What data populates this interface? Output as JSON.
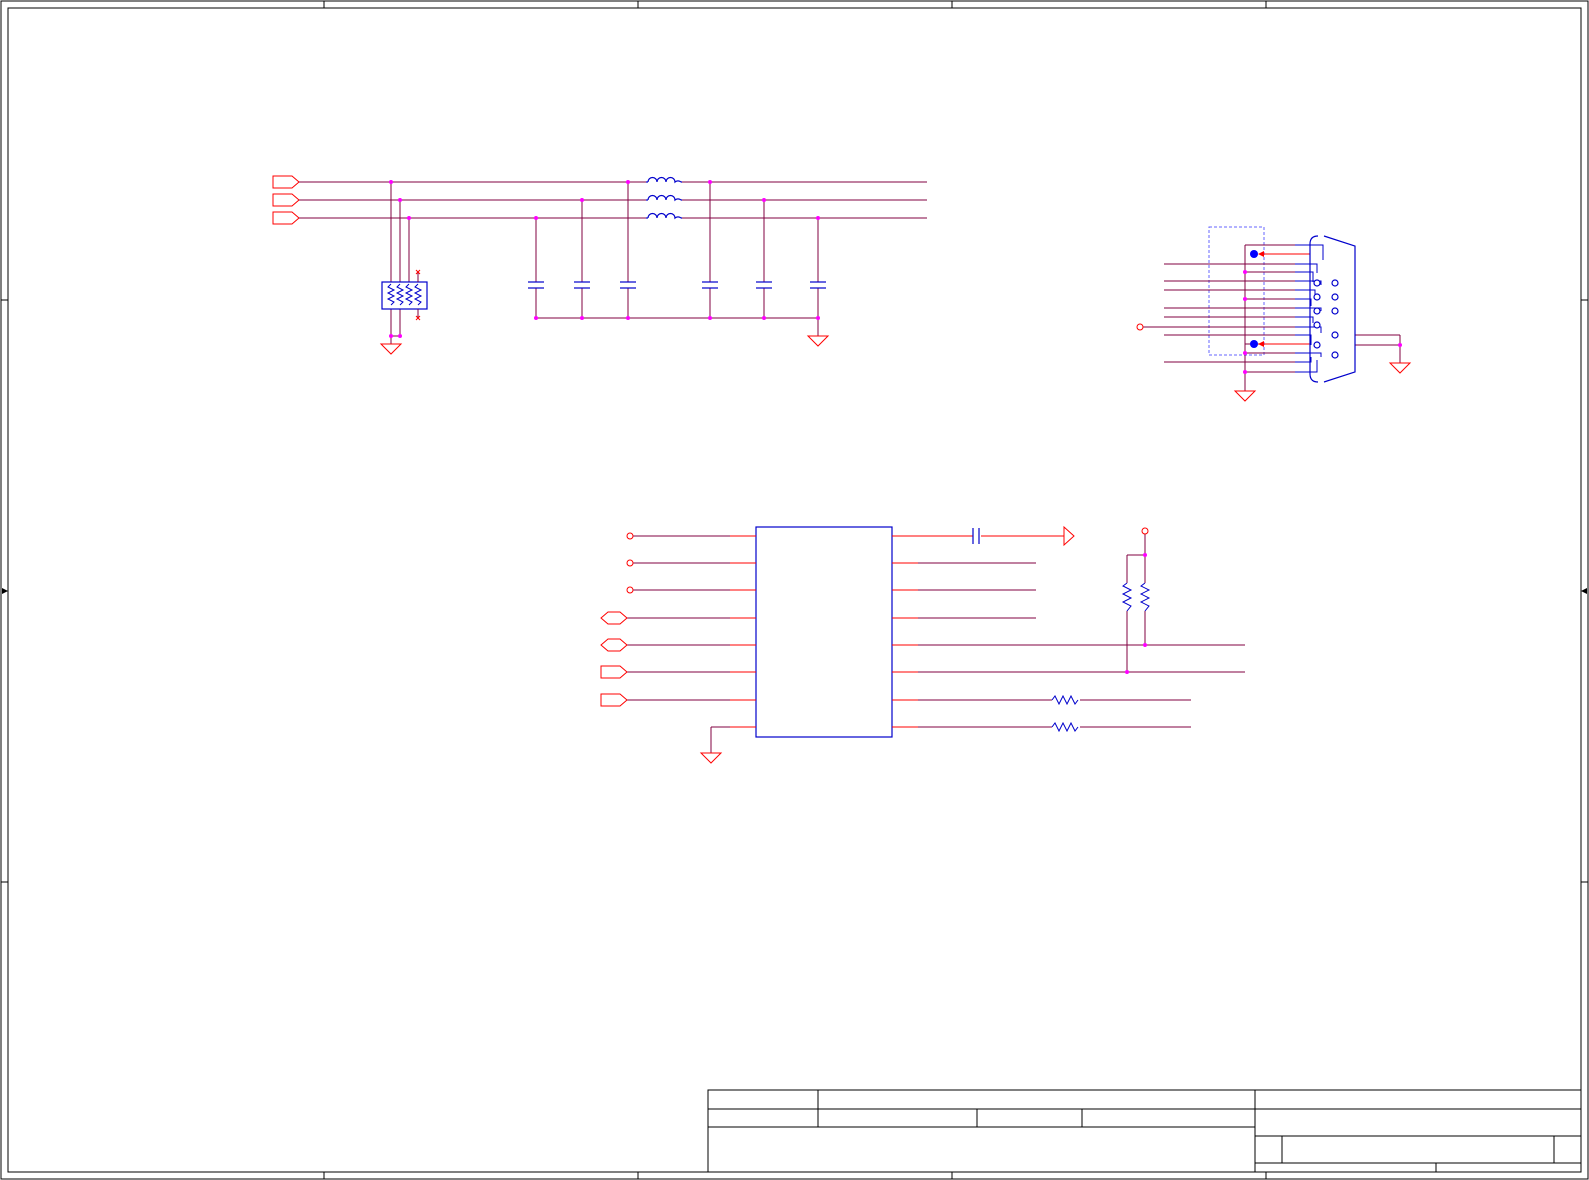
{
  "colors": {
    "background": "#ffffff",
    "border": "#000000",
    "wire": "#800040",
    "net_label": "#ff0000",
    "junction": "#ff00ff",
    "component": "#0000cc",
    "shield": "#6666ff"
  },
  "sheet": {
    "frame": "drawing-border-with-zone-ticks",
    "title_block": "empty"
  },
  "sections": [
    {
      "name": "emi-filter-network",
      "parts": [
        "inductor",
        "inductor",
        "inductor",
        "capacitor",
        "capacitor",
        "capacitor",
        "capacitor",
        "capacitor",
        "capacitor",
        "resistor-array"
      ]
    },
    {
      "name": "db-connector",
      "parts": [
        "connector"
      ]
    },
    {
      "name": "ic-block",
      "parts": [
        "ic",
        "capacitor",
        "resistor",
        "resistor",
        "resistor",
        "resistor"
      ]
    }
  ],
  "icons": [
    "ground-icon",
    "inductor-icon",
    "capacitor-icon",
    "resistor-icon",
    "connector-icon",
    "net-port-icon"
  ]
}
